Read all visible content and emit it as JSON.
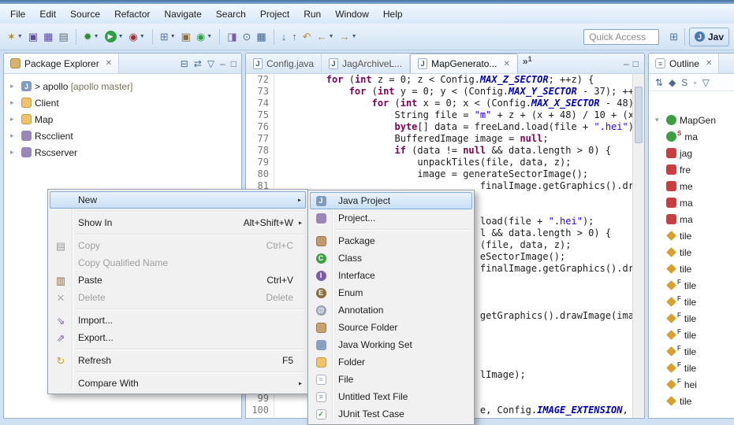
{
  "colors": {
    "menu_highlight": "#c9dff5",
    "keyword": "#7f0055",
    "string": "#2a00ff",
    "static_field": "#0000c0",
    "line_number": "#787878"
  },
  "menubar": {
    "items": [
      "File",
      "Edit",
      "Source",
      "Refactor",
      "Navigate",
      "Search",
      "Project",
      "Run",
      "Window",
      "Help"
    ]
  },
  "toolbar": {
    "quick_access": "Quick Access",
    "perspective_label": "Jav",
    "buttons": [
      {
        "name": "new-wizard",
        "glyph": "✶",
        "fg": "#b58c2a",
        "dropdown": true
      },
      {
        "name": "save",
        "glyph": "▣",
        "fg": "#5b4a9e"
      },
      {
        "name": "save-all",
        "glyph": "▦",
        "fg": "#5b4a9e"
      },
      {
        "name": "print",
        "glyph": "▤",
        "fg": "#5a6b7d"
      },
      {
        "sep": true
      },
      {
        "name": "debug",
        "glyph": "✹",
        "fg": "#2e8b2e",
        "dropdown": true
      },
      {
        "name": "run",
        "glyph": "▶",
        "fg": "#ffffff",
        "bg": "#2f9e44",
        "dropdown": true
      },
      {
        "name": "coverage",
        "glyph": "◉",
        "fg": "#a03030",
        "dropdown": true
      },
      {
        "sep": true
      },
      {
        "name": "new-java-project",
        "glyph": "⊞",
        "fg": "#5a76a0",
        "dropdown": true
      },
      {
        "name": "new-java-package",
        "glyph": "▣",
        "fg": "#8a6d3b"
      },
      {
        "name": "new-java-class",
        "glyph": "◉",
        "fg": "#2f9e44",
        "dropdown": true
      },
      {
        "sep": true
      },
      {
        "name": "open-jar",
        "glyph": "◨",
        "fg": "#7b5ea7"
      },
      {
        "name": "search",
        "glyph": "⊙",
        "fg": "#5a6b7d"
      },
      {
        "name": "open-table",
        "glyph": "▦",
        "fg": "#44608c"
      },
      {
        "sep": true
      },
      {
        "name": "next-annotation",
        "glyph": "↓",
        "fg": "#5a6b7d"
      },
      {
        "name": "previous-annotation",
        "glyph": "↑",
        "fg": "#5a6b7d"
      },
      {
        "name": "last-edit-location",
        "glyph": "↶",
        "fg": "#b58c2a"
      },
      {
        "name": "back",
        "glyph": "←",
        "fg": "#b58c2a",
        "dropdown": true
      },
      {
        "name": "forward",
        "glyph": "→",
        "fg": "#b58c2a",
        "dropdown": true
      }
    ]
  },
  "package_explorer": {
    "title": "Package Explorer",
    "view_toolbar": [
      {
        "name": "collapse-all",
        "glyph": "⊟"
      },
      {
        "name": "link-with-editor",
        "glyph": "⇄"
      },
      {
        "name": "view-menu",
        "glyph": "▽"
      },
      {
        "name": "minimize",
        "glyph": "–"
      },
      {
        "name": "maximize",
        "glyph": "□"
      }
    ],
    "items": [
      {
        "name": "apollo",
        "prefix": "> ",
        "decoration": "[apollo master]",
        "icon": "java-project"
      },
      {
        "name": "Client",
        "icon": "folder"
      },
      {
        "name": "Map",
        "icon": "folder"
      },
      {
        "name": "Rscclient",
        "icon": "project"
      },
      {
        "name": "Rscserver",
        "icon": "project"
      }
    ]
  },
  "editor": {
    "tabs": [
      {
        "label": "Config.java",
        "active": false
      },
      {
        "label": "JagArchiveL...",
        "active": false
      },
      {
        "label": "MapGenerato...",
        "active": true
      }
    ],
    "overflow_count": "1",
    "lines": [
      {
        "n": "72",
        "col": 8,
        "segs": [
          [
            "k",
            "for"
          ],
          [
            "p",
            " ("
          ],
          [
            "k",
            "int"
          ],
          [
            "p",
            " z = 0; z < Config."
          ],
          [
            "f",
            "MAX_Z_SECTOR"
          ],
          [
            "p",
            "; ++z) {"
          ]
        ]
      },
      {
        "n": "73",
        "col": 12,
        "segs": [
          [
            "k",
            "for"
          ],
          [
            "p",
            " ("
          ],
          [
            "k",
            "int"
          ],
          [
            "p",
            " y = 0; y < (Config."
          ],
          [
            "f",
            "MAX_Y_SECTOR"
          ],
          [
            "p",
            " - 37); ++"
          ]
        ]
      },
      {
        "n": "74",
        "col": 16,
        "segs": [
          [
            "k",
            "for"
          ],
          [
            "p",
            " ("
          ],
          [
            "k",
            "int"
          ],
          [
            "p",
            " x = 0; x < (Config."
          ],
          [
            "f",
            "MAX_X_SECTOR"
          ],
          [
            "p",
            " - 48)"
          ]
        ]
      },
      {
        "n": "75",
        "col": 20,
        "segs": [
          [
            "p",
            "String file = "
          ],
          [
            "s",
            "\"m\""
          ],
          [
            "p",
            " + z + (x + 48) / 10 + (x"
          ]
        ]
      },
      {
        "n": "76",
        "col": 20,
        "segs": [
          [
            "k",
            "byte"
          ],
          [
            "p",
            "[] data = freeLand.load(file + "
          ],
          [
            "s",
            "\".hei\""
          ],
          [
            "p",
            ");"
          ]
        ]
      },
      {
        "n": "77",
        "col": 20,
        "segs": [
          [
            "p",
            "BufferedImage image = "
          ],
          [
            "k",
            "null"
          ],
          [
            "p",
            ";"
          ]
        ]
      },
      {
        "n": "78",
        "col": 20,
        "segs": [
          [
            "k",
            "if"
          ],
          [
            "p",
            " (data != "
          ],
          [
            "k",
            "null"
          ],
          [
            "p",
            " && data.length > 0) {"
          ]
        ]
      },
      {
        "n": "79",
        "col": 24,
        "segs": [
          [
            "p",
            "unpackTiles(file, data, z);"
          ]
        ]
      },
      {
        "n": "80",
        "col": 24,
        "segs": [
          [
            "p",
            "image = generateSectorImage();"
          ]
        ]
      },
      {
        "n": "81",
        "col": 35,
        "segs": [
          [
            "p",
            "finalImage.getGraphics().dr"
          ]
        ]
      },
      {
        "n": "82",
        "col": 0,
        "segs": []
      },
      {
        "n": "83",
        "col": 0,
        "segs": []
      },
      {
        "n": "84",
        "col": 35,
        "segs": [
          [
            "p",
            "load(file + "
          ],
          [
            "s",
            "\".hei\""
          ],
          [
            "p",
            ");"
          ]
        ]
      },
      {
        "n": "85",
        "col": 35,
        "segs": [
          [
            "p",
            "l && data.length > 0) {"
          ]
        ]
      },
      {
        "n": "86",
        "col": 35,
        "segs": [
          [
            "p",
            "(file, data, z);"
          ]
        ]
      },
      {
        "n": "87",
        "col": 35,
        "segs": [
          [
            "p",
            "eSectorImage();"
          ]
        ]
      },
      {
        "n": "88",
        "col": 35,
        "segs": [
          [
            "p",
            "finalImage.getGraphics().dr"
          ]
        ]
      },
      {
        "n": "89",
        "col": 0,
        "segs": []
      },
      {
        "n": "90",
        "col": 0,
        "segs": []
      },
      {
        "n": "91",
        "col": 0,
        "segs": []
      },
      {
        "n": "92",
        "col": 35,
        "segs": [
          [
            "p",
            "getGraphics().drawImage(imag"
          ]
        ]
      },
      {
        "n": "93",
        "col": 0,
        "segs": []
      },
      {
        "n": "94",
        "col": 0,
        "segs": []
      },
      {
        "n": "95",
        "col": 0,
        "segs": []
      },
      {
        "n": "96",
        "col": 0,
        "segs": []
      },
      {
        "n": "97",
        "col": 35,
        "segs": [
          [
            "p",
            "lImage);"
          ]
        ]
      },
      {
        "n": "98",
        "col": 0,
        "segs": []
      },
      {
        "n": "99",
        "col": 0,
        "segs": []
      },
      {
        "n": "100",
        "col": 35,
        "segs": [
          [
            "p",
            "e, Config."
          ],
          [
            "f",
            "IMAGE_EXTENSION"
          ],
          [
            "p",
            ", "
          ]
        ]
      }
    ]
  },
  "outline": {
    "title": "Outline",
    "view_toolbar": [
      {
        "name": "sort",
        "glyph": "⇅"
      },
      {
        "name": "hide-fields",
        "glyph": "◆"
      },
      {
        "name": "hide-static",
        "glyph": "S"
      },
      {
        "name": "hide-non-public",
        "glyph": "◦"
      },
      {
        "name": "view-menu",
        "glyph": "▽"
      }
    ],
    "items": [
      {
        "label": "MapGen",
        "kind": "class",
        "expanded": true
      },
      {
        "label": "ma",
        "kind": "method-static"
      },
      {
        "label": "jag",
        "kind": "field-private"
      },
      {
        "label": "fre",
        "kind": "field-private"
      },
      {
        "label": "me",
        "kind": "field-private"
      },
      {
        "label": "ma",
        "kind": "field-private"
      },
      {
        "label": "ma",
        "kind": "field-private"
      },
      {
        "label": "tile",
        "kind": "field-default"
      },
      {
        "label": "tile",
        "kind": "field-default"
      },
      {
        "label": "tile",
        "kind": "field-default"
      },
      {
        "label": "tile",
        "kind": "field-final"
      },
      {
        "label": "tile",
        "kind": "field-final"
      },
      {
        "label": "tile",
        "kind": "field-final"
      },
      {
        "label": "tile",
        "kind": "field-final"
      },
      {
        "label": "tile",
        "kind": "field-final"
      },
      {
        "label": "tile",
        "kind": "field-final"
      },
      {
        "label": "hei",
        "kind": "field-final"
      },
      {
        "label": "tile",
        "kind": "field-default"
      }
    ]
  },
  "context_menu": {
    "items": [
      {
        "label": "New",
        "submenu": true,
        "highlighted": true
      },
      {
        "sep": true
      },
      {
        "label": "Show In",
        "shortcut": "Alt+Shift+W",
        "submenu": true
      },
      {
        "sep": true
      },
      {
        "label": "Copy",
        "shortcut": "Ctrl+C",
        "icon": "copy",
        "disabled": true
      },
      {
        "label": "Copy Qualified Name",
        "disabled": true
      },
      {
        "label": "Paste",
        "shortcut": "Ctrl+V",
        "icon": "paste"
      },
      {
        "label": "Delete",
        "shortcut": "Delete",
        "icon": "delete",
        "disabled": true
      },
      {
        "sep": true
      },
      {
        "label": "Import...",
        "icon": "import"
      },
      {
        "label": "Export...",
        "icon": "export"
      },
      {
        "sep": true
      },
      {
        "label": "Refresh",
        "shortcut": "F5",
        "icon": "refresh"
      },
      {
        "sep": true
      },
      {
        "label": "Compare With",
        "submenu": true
      }
    ]
  },
  "new_submenu": {
    "items": [
      {
        "label": "Java Project",
        "icon": "java-project",
        "highlighted": true
      },
      {
        "label": "Project...",
        "icon": "project"
      },
      {
        "sep": true
      },
      {
        "label": "Package",
        "icon": "package"
      },
      {
        "label": "Class",
        "icon": "class"
      },
      {
        "label": "Interface",
        "icon": "interface"
      },
      {
        "label": "Enum",
        "icon": "enum"
      },
      {
        "label": "Annotation",
        "icon": "annotation"
      },
      {
        "label": "Source Folder",
        "icon": "source-folder"
      },
      {
        "label": "Java Working Set",
        "icon": "working-set"
      },
      {
        "label": "Folder",
        "icon": "folder"
      },
      {
        "label": "File",
        "icon": "file"
      },
      {
        "label": "Untitled Text File",
        "icon": "text-file"
      },
      {
        "label": "JUnit Test Case",
        "icon": "junit"
      }
    ]
  }
}
